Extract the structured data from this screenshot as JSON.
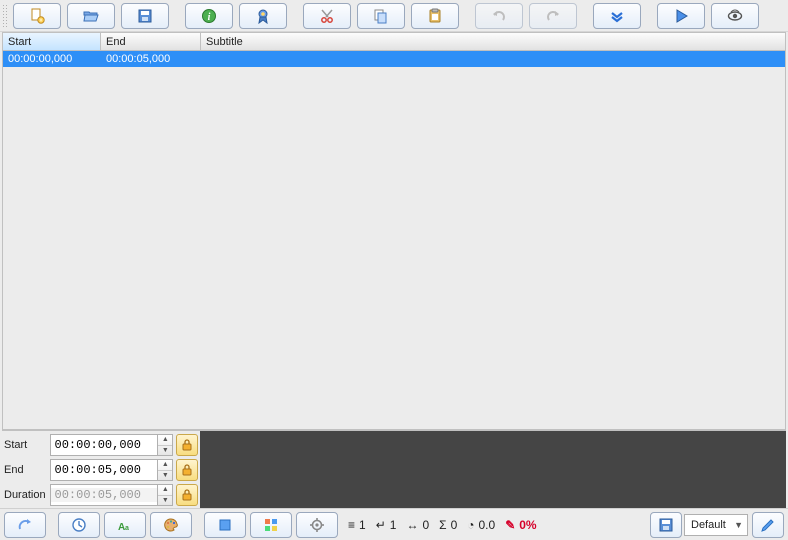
{
  "toolbar": {
    "buttons": [
      {
        "name": "new-file-button",
        "icon": "file-new"
      },
      {
        "name": "open-file-button",
        "icon": "folder-open"
      },
      {
        "name": "save-file-button",
        "icon": "save"
      },
      {
        "name": "info-button",
        "icon": "info"
      },
      {
        "name": "character-button",
        "icon": "ribbon"
      },
      {
        "name": "cut-button",
        "icon": "cut"
      },
      {
        "name": "copy-button",
        "icon": "copy"
      },
      {
        "name": "paste-button",
        "icon": "paste"
      },
      {
        "name": "undo-button",
        "icon": "undo",
        "disabled": true
      },
      {
        "name": "redo-button",
        "icon": "redo",
        "disabled": true
      },
      {
        "name": "expand-button",
        "icon": "expand"
      },
      {
        "name": "play-button",
        "icon": "play"
      },
      {
        "name": "preview-button",
        "icon": "eye"
      }
    ]
  },
  "grid": {
    "columns": [
      "Start",
      "End",
      "Subtitle"
    ],
    "rows": [
      {
        "start": "00:00:00,000",
        "end": "00:00:05,000",
        "subtitle": ""
      }
    ],
    "selected": 0
  },
  "time": {
    "start": {
      "label": "Start",
      "value": "00:00:00,000"
    },
    "end": {
      "label": "End",
      "value": "00:00:05,000"
    },
    "duration": {
      "label": "Duration",
      "value": "00:00:05,000",
      "disabled": true
    }
  },
  "bottom": {
    "style_selected": "Default",
    "stats": {
      "lines": "1",
      "char_per_line": "1",
      "max_line": "0",
      "total": "0",
      "cps": "0.0",
      "error_pct": "0%"
    }
  }
}
